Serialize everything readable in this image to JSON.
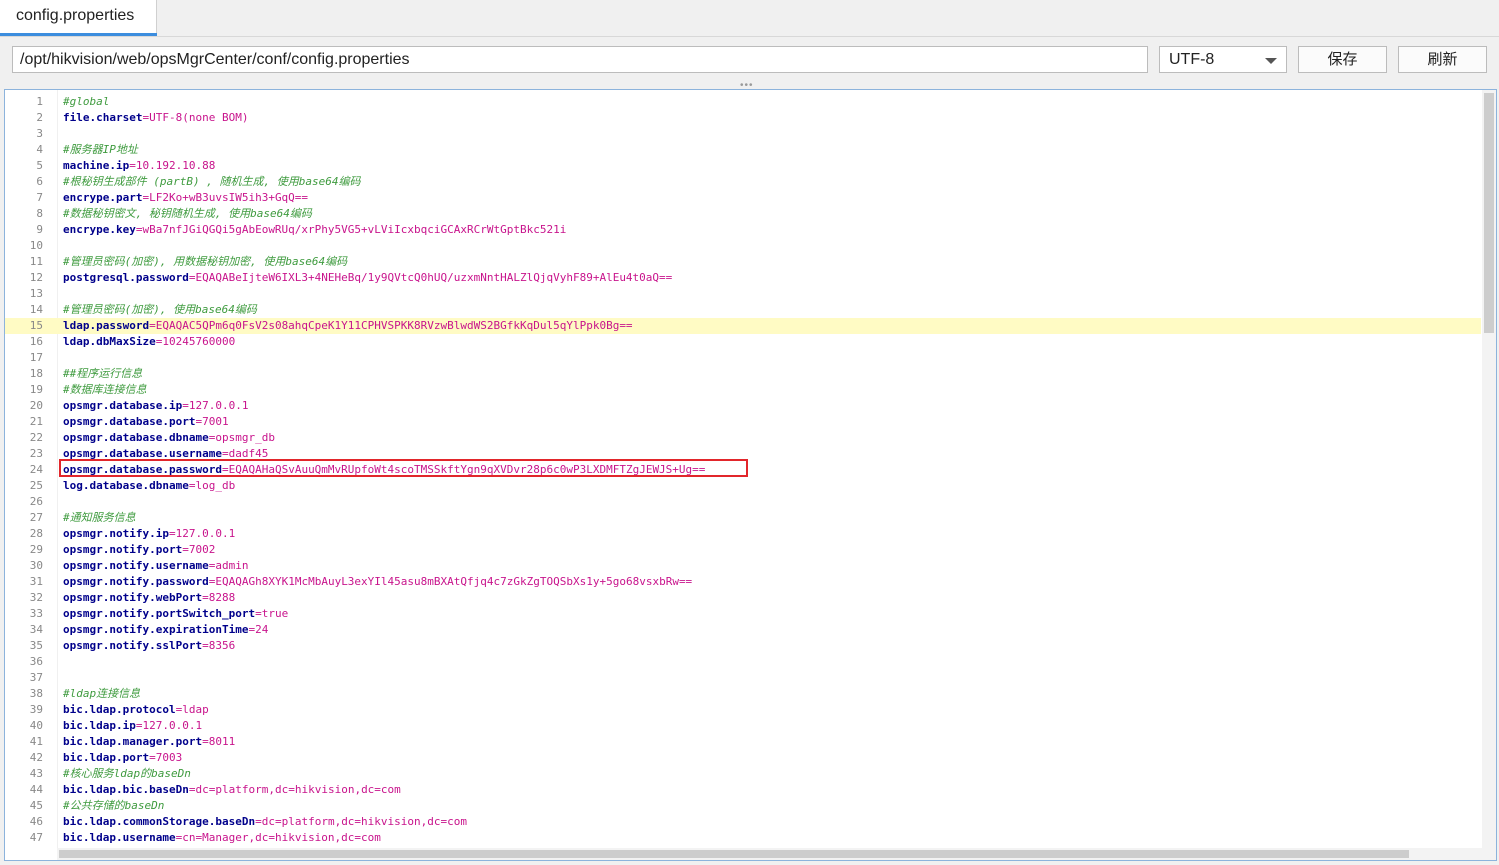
{
  "tab": {
    "title": "config.properties"
  },
  "toolbar": {
    "path": "/opt/hikvision/web/opsMgrCenter/conf/config.properties",
    "encoding": "UTF-8",
    "save_label": "保存",
    "refresh_label": "刷新"
  },
  "editor": {
    "highlighted_line": 15,
    "boxed_line": 24,
    "lines": [
      {
        "n": "1",
        "c": "#global"
      },
      {
        "n": "2",
        "k": "file.charset",
        "v": "UTF-8(none BOM)"
      },
      {
        "n": "3"
      },
      {
        "n": "4",
        "c": "#服务器IP地址"
      },
      {
        "n": "5",
        "k": "machine.ip",
        "v": "10.192.10.88"
      },
      {
        "n": "6",
        "c": "#根秘钥生成部件 (partB) , 随机生成, 使用base64编码"
      },
      {
        "n": "7",
        "k": "encrype.part",
        "v": "LF2Ko+wB3uvsIW5ih3+GqQ=="
      },
      {
        "n": "8",
        "c": "#数据秘钥密文, 秘钥随机生成, 使用base64编码"
      },
      {
        "n": "9",
        "k": "encrype.key",
        "v": "wBa7nfJGiQGQi5gAbEowRUq/xrPhy5VG5+vLViIcxbqciGCAxRCrWtGptBkc521i"
      },
      {
        "n": "10"
      },
      {
        "n": "11",
        "c": "#管理员密码(加密), 用数据秘钥加密, 使用base64编码"
      },
      {
        "n": "12",
        "k": "postgresql.password",
        "v": "EQAQABeIjteW6IXL3+4NEHeBq/1y9QVtcQ0hUQ/uzxmNntHALZlQjqVyhF89+AlEu4t0aQ=="
      },
      {
        "n": "13"
      },
      {
        "n": "14",
        "c": "#管理员密码(加密), 使用base64编码"
      },
      {
        "n": "15",
        "k": "ldap.password",
        "v": "EQAQAC5QPm6q0FsV2s08ahqCpeK1Y11CPHVSPKK8RVzwBlwdWS2BGfkKqDul5qYlPpk0Bg=="
      },
      {
        "n": "16",
        "k": "ldap.dbMaxSize",
        "v": "10245760000"
      },
      {
        "n": "17"
      },
      {
        "n": "18",
        "c": "##程序运行信息"
      },
      {
        "n": "19",
        "c": "#数据库连接信息"
      },
      {
        "n": "20",
        "k": "opsmgr.database.ip",
        "v": "127.0.0.1"
      },
      {
        "n": "21",
        "k": "opsmgr.database.port",
        "v": "7001"
      },
      {
        "n": "22",
        "k": "opsmgr.database.dbname",
        "v": "opsmgr_db"
      },
      {
        "n": "23",
        "k": "opsmgr.database.username",
        "v": "dadf45"
      },
      {
        "n": "24",
        "k": "opsmgr.database.password",
        "v": "EQAQAHaQSvAuuQmMvRUpfoWt4scoTMSSkftYgn9qXVDvr28p6c0wP3LXDMFTZgJEWJS+Ug=="
      },
      {
        "n": "25",
        "k": "log.database.dbname",
        "v": "log_db"
      },
      {
        "n": "26"
      },
      {
        "n": "27",
        "c": "#通知服务信息"
      },
      {
        "n": "28",
        "k": "opsmgr.notify.ip",
        "v": "127.0.0.1"
      },
      {
        "n": "29",
        "k": "opsmgr.notify.port",
        "v": "7002"
      },
      {
        "n": "30",
        "k": "opsmgr.notify.username",
        "v": "admin"
      },
      {
        "n": "31",
        "k": "opsmgr.notify.password",
        "v": "EQAQAGh8XYK1McMbAuyL3exYIl45asu8mBXAtQfjq4c7zGkZgTOQSbXs1y+5go68vsxbRw=="
      },
      {
        "n": "32",
        "k": "opsmgr.notify.webPort",
        "v": "8288"
      },
      {
        "n": "33",
        "k": "opsmgr.notify.portSwitch_port",
        "v": "true"
      },
      {
        "n": "34",
        "k": "opsmgr.notify.expirationTime",
        "v": "24"
      },
      {
        "n": "35",
        "k": "opsmgr.notify.sslPort",
        "v": "8356"
      },
      {
        "n": "36"
      },
      {
        "n": "37"
      },
      {
        "n": "38",
        "c": "#ldap连接信息"
      },
      {
        "n": "39",
        "k": "bic.ldap.protocol",
        "v": "ldap"
      },
      {
        "n": "40",
        "k": "bic.ldap.ip",
        "v": "127.0.0.1"
      },
      {
        "n": "41",
        "k": "bic.ldap.manager.port",
        "v": "8011"
      },
      {
        "n": "42",
        "k": "bic.ldap.port",
        "v": "7003"
      },
      {
        "n": "43",
        "c": "#核心服务ldap的baseDn"
      },
      {
        "n": "44",
        "k": "bic.ldap.bic.baseDn",
        "v": "dc=platform,dc=hikvision,dc=com"
      },
      {
        "n": "45",
        "c": "#公共存储的baseDn"
      },
      {
        "n": "46",
        "k": "bic.ldap.commonStorage.baseDn",
        "v": "dc=platform,dc=hikvision,dc=com"
      },
      {
        "n": "47",
        "k": "bic.ldap.username",
        "v": "cn=Manager,dc=hikvision,dc=com"
      }
    ]
  }
}
